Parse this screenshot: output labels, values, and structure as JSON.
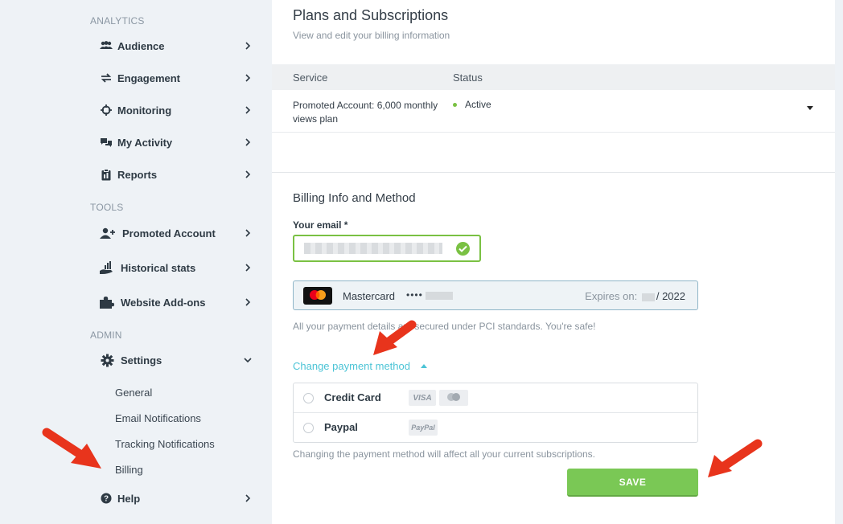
{
  "sidebar": {
    "sections": {
      "analytics": "ANALYTICS",
      "tools": "TOOLS",
      "admin": "ADMIN"
    },
    "items": [
      {
        "label": "Audience",
        "icon": "audience-icon"
      },
      {
        "label": "Engagement",
        "icon": "engagement-icon"
      },
      {
        "label": "Monitoring",
        "icon": "crosshair-icon"
      },
      {
        "label": "My Activity",
        "icon": "chat-icon"
      },
      {
        "label": "Reports",
        "icon": "clipboard-icon"
      },
      {
        "label": "Promoted Account",
        "icon": "user-plus-icon"
      },
      {
        "label": "Historical stats",
        "icon": "hand-chart-icon"
      },
      {
        "label": "Website Add-ons",
        "icon": "puzzle-icon"
      },
      {
        "label": "Settings",
        "icon": "gear-icon"
      },
      {
        "label": "Help",
        "icon": "question-icon"
      }
    ],
    "settings_sub": [
      "General",
      "Email Notifications",
      "Tracking Notifications",
      "Billing"
    ]
  },
  "main": {
    "title": "Plans and Subscriptions",
    "subtitle": "View and edit your billing information",
    "table": {
      "headers": [
        "Service",
        "Status"
      ],
      "rows": [
        {
          "service": "Promoted Account: 6,000 monthly views plan",
          "status": "Active"
        }
      ]
    },
    "billing": {
      "title": "Billing Info and Method",
      "email_label": "Your email *",
      "card": {
        "brand": "Mastercard",
        "dots": "••••",
        "expires_label": "Expires on:",
        "expires_year": "/ 2022"
      },
      "pci_note": "All your payment details are secured under PCI standards. You're safe!",
      "change_link": "Change payment method",
      "options": [
        {
          "label": "Credit Card",
          "badges": [
            "VISA"
          ]
        },
        {
          "label": "Paypal",
          "badges": [
            "PayPal"
          ]
        }
      ],
      "payment_note": "Changing the payment method will affect all your current subscriptions.",
      "save_label": "SAVE"
    }
  },
  "colors": {
    "accent_green": "#7ac855",
    "link_teal": "#4cc4d6",
    "arrow_red": "#e8341c"
  }
}
